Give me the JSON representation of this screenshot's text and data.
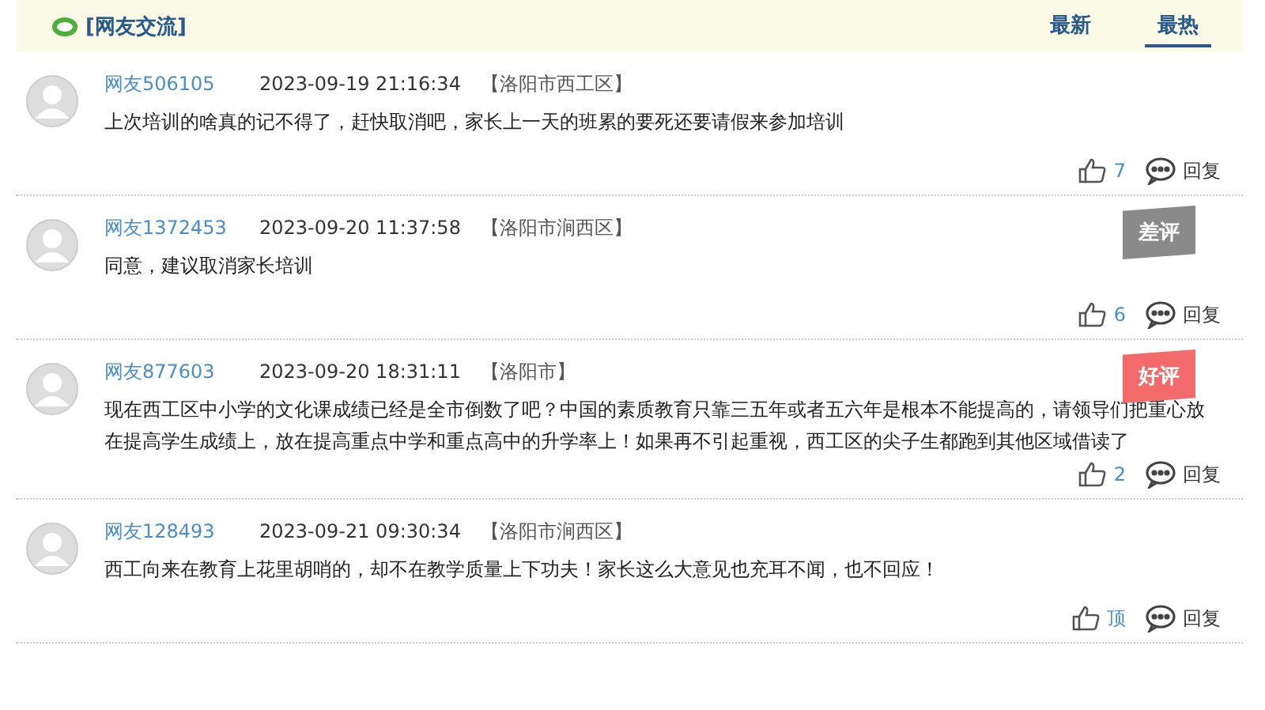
{
  "header": {
    "title": "[网友交流]",
    "tabs": [
      {
        "label": "最新",
        "selected": false
      },
      {
        "label": "最热",
        "selected": true
      }
    ]
  },
  "comments": [
    {
      "user": "网友506105",
      "time": "2023-09-19 21:16:34",
      "location": "【洛阳市西工区】",
      "text": "上次培训的啥真的记不得了，赶快取消吧，家长上一天的班累的要死还要请假来参加培训",
      "likes": "7",
      "reply": "回复"
    },
    {
      "user": "网友1372453",
      "time": "2023-09-20 11:37:58",
      "location": "【洛阳市涧西区】",
      "text": "同意，建议取消家长培训",
      "likes": "6",
      "reply": "回复",
      "badge": {
        "kind": "bad",
        "label": "差评"
      }
    },
    {
      "user": "网友877603",
      "time": "2023-09-20 18:31:11",
      "location": "【洛阳市】",
      "text": "现在西工区中小学的文化课成绩已经是全市倒数了吧？中国的素质教育只靠三五年或者五六年是根本不能提高的，请领导们把重心放在提高学生成绩上，放在提高重点中学和重点高中的升学率上！如果再不引起重视，西工区的尖子生都跑到其他区域借读了",
      "likes": "2",
      "reply": "回复",
      "badge": {
        "kind": "good",
        "label": "好评"
      }
    },
    {
      "user": "网友128493",
      "time": "2023-09-21 09:30:34",
      "location": "【洛阳市涧西区】",
      "text": "西工向来在教育上花里胡哨的，却不在教学质量上下功夫！家长这么大意见也充耳不闻，也不回应！",
      "likes": "顶",
      "reply": "回复"
    }
  ]
}
